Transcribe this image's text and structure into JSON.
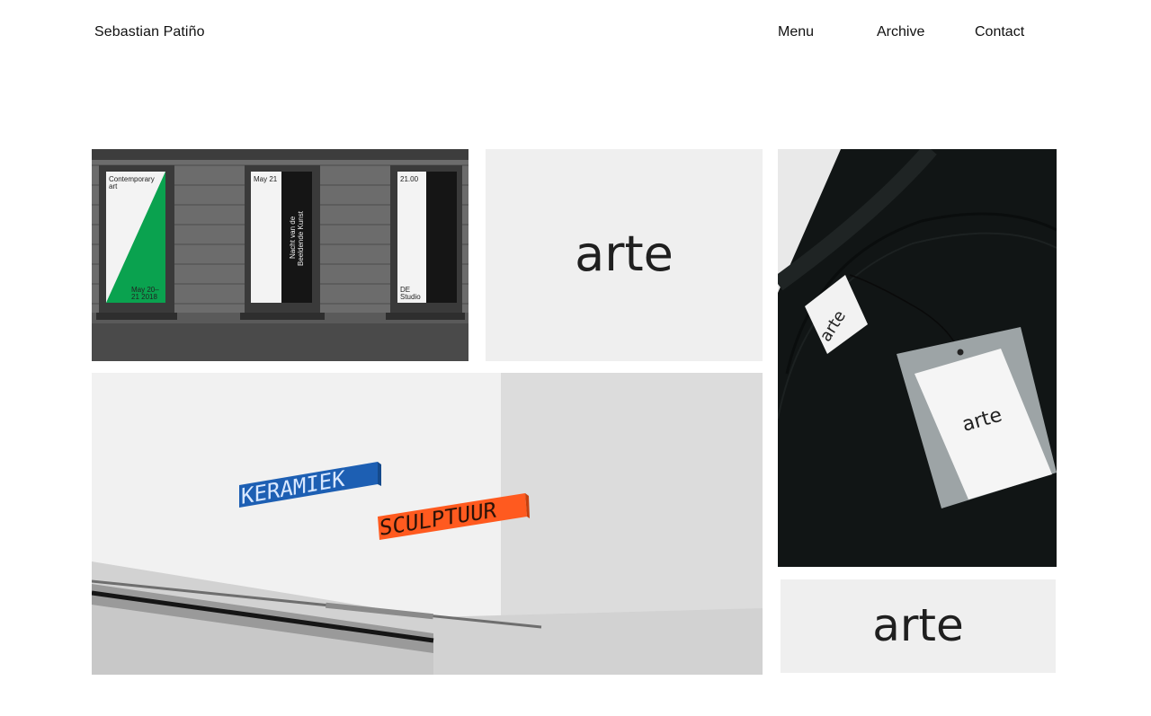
{
  "header": {
    "site_name": "Sebastian Patiño",
    "nav": {
      "menu": "Menu",
      "archive": "Archive",
      "contact": "Contact"
    }
  },
  "gallery": {
    "facade_banners": {
      "banner_1": {
        "top_line_1": "Contemporary",
        "top_line_2": "art",
        "bottom_line_1": "May 20–",
        "bottom_line_2": "21 2018"
      },
      "banner_2": {
        "top": "May 21",
        "side_line_1": "Nacht van de",
        "side_line_2": "Beeldende Kunst"
      },
      "banner_3": {
        "top": "21.00",
        "bottom_line_1": "DE",
        "bottom_line_2": "Studio"
      },
      "accent_green": "#0aa24f"
    },
    "logo_card_top": {
      "wordmark": "arte",
      "background": "#efefef"
    },
    "signage": {
      "sign_blue": "KERAMIEK",
      "sign_orange": "SCULPTUUR",
      "blue": "#1d5fb3",
      "orange": "#ff5a1f"
    },
    "sweater": {
      "neck_label": "arte",
      "hang_tag": "arte"
    },
    "logo_card_bottom": {
      "wordmark": "arte",
      "background": "#efefef"
    }
  }
}
